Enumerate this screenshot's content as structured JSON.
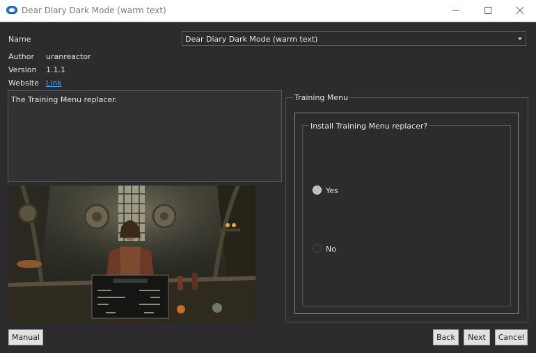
{
  "window": {
    "title": "Dear Diary Dark Mode (warm text)",
    "icon": "app-icon",
    "controls": [
      "minimize-icon",
      "maximize-icon",
      "close-icon"
    ]
  },
  "info": {
    "name_label": "Name",
    "name_value": "Dear Diary Dark Mode (warm text)",
    "author_label": "Author",
    "author_value": "uranreactor",
    "version_label": "Version",
    "version_value": "1.1.1",
    "website_label": "Website",
    "website_link": "Link"
  },
  "description": "The Training Menu replacer.",
  "preview_image": "Skyrim trainer screenshot",
  "group": {
    "title": "Training Menu",
    "question": "Install Training Menu replacer?",
    "options": [
      {
        "label": "Yes",
        "selected": true
      },
      {
        "label": "No",
        "selected": false
      }
    ]
  },
  "buttons": {
    "manual": "Manual",
    "back": "Back",
    "next": "Next",
    "cancel": "Cancel"
  },
  "colors": {
    "background": "#2c2c2e",
    "link": "#3c9bff",
    "text": "#e6e6e6"
  }
}
